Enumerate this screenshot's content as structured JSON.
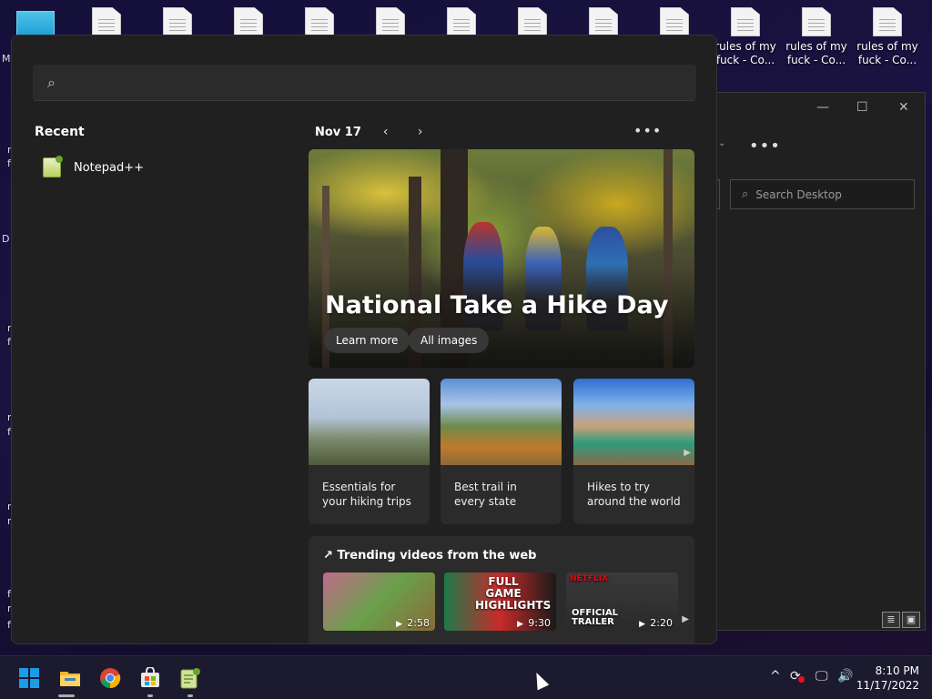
{
  "desktop": {
    "icons": [
      {
        "label": ""
      },
      {
        "label": ""
      },
      {
        "label": ""
      },
      {
        "label": ""
      },
      {
        "label": ""
      },
      {
        "label": ""
      },
      {
        "label": ""
      },
      {
        "label": ""
      },
      {
        "label": ""
      },
      {
        "label": "rules of my fuck - Co..."
      },
      {
        "label": "rules of my fuck - Co..."
      },
      {
        "label": "rules of my fuck - Co..."
      }
    ],
    "left_fragments": [
      "M",
      "n",
      "f",
      "D",
      "n",
      "f",
      "n",
      "f",
      "n",
      "n",
      "f",
      "n",
      "f"
    ]
  },
  "explorer": {
    "minimize": "—",
    "maximize": "☐",
    "close": "✕",
    "more": "•••",
    "search_placeholder": "Search Desktop"
  },
  "start_menu": {
    "search_placeholder": "",
    "recent_title": "Recent",
    "recent_items": [
      {
        "label": "Notepad++"
      }
    ],
    "date": "Nov 17",
    "prev": "‹",
    "next": "›",
    "more": "•••",
    "hero": {
      "title": "National Take a Hike Day",
      "learn_more": "Learn more",
      "all_images": "All images"
    },
    "cards": [
      {
        "text": "Essentials for your hiking trips"
      },
      {
        "text": "Best trail in every state"
      },
      {
        "text": "Hikes to try around the world"
      }
    ],
    "trending": {
      "title": "Trending videos from the web",
      "videos": [
        {
          "duration": "2:58",
          "overlay": ""
        },
        {
          "duration": "9:30",
          "overlay": "FULL GAME HIGHLIGHTS"
        },
        {
          "duration": "2:20",
          "overlay": "OFFICIAL TRAILER",
          "brand": "NETFLIX"
        }
      ]
    }
  },
  "taskbar": {
    "apps": [
      "start-icon",
      "file-explorer-icon",
      "chrome-icon",
      "store-icon",
      "notepadpp-icon"
    ],
    "tray_chevron": "^",
    "time": "8:10 PM",
    "date": "11/17/2022"
  },
  "colors": {
    "menu_bg": "#202020",
    "card_bg": "#2b2b2b",
    "taskbar_bg": "#1c1a2e",
    "windows_blue": "#1b9ce8"
  }
}
